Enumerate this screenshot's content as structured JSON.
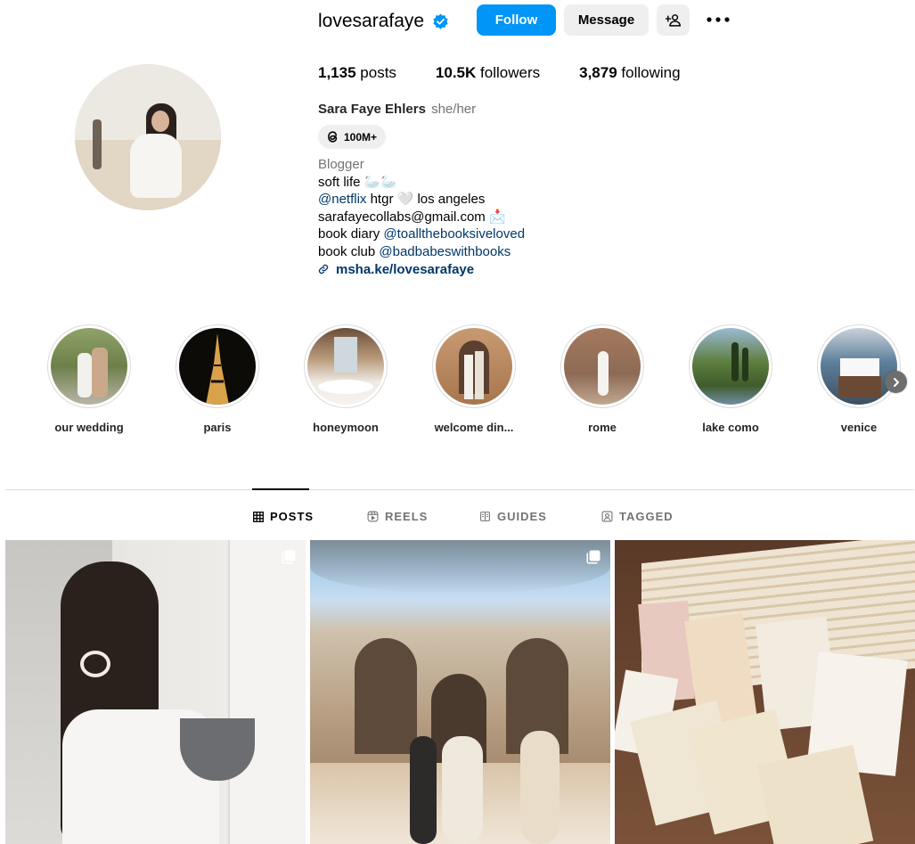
{
  "profile": {
    "username": "lovesarafaye",
    "follow_label": "Follow",
    "message_label": "Message",
    "posts_count": "1,135",
    "posts_label": "posts",
    "followers_count": "10.5K",
    "followers_label": "followers",
    "following_count": "3,879",
    "following_label": "following",
    "full_name": "Sara Faye Ehlers",
    "pronouns": "she/her",
    "threads_badge": "100M+",
    "category": "Blogger",
    "bio_line1": "soft life 🦢🦢",
    "bio_line2_mention": "@netflix",
    "bio_line2_rest": " htgr 🤍 los angeles",
    "bio_line3": "sarafayecollabs@gmail.com 📩",
    "bio_line4_text": "book diary ",
    "bio_line4_mention": "@toallthebooksiveloved",
    "bio_line5_text": "book club ",
    "bio_line5_mention": "@badbabeswithbooks",
    "link": "msha.ke/lovesarafaye"
  },
  "highlights": [
    {
      "label": "our wedding"
    },
    {
      "label": "paris"
    },
    {
      "label": "honeymoon"
    },
    {
      "label": "welcome din..."
    },
    {
      "label": "rome"
    },
    {
      "label": "lake como"
    },
    {
      "label": "venice"
    }
  ],
  "tabs": {
    "posts": "POSTS",
    "reels": "REELS",
    "guides": "GUIDES",
    "tagged": "TAGGED"
  },
  "colors": {
    "accent": "#0095f6",
    "link": "#00376b",
    "muted": "#737373"
  }
}
